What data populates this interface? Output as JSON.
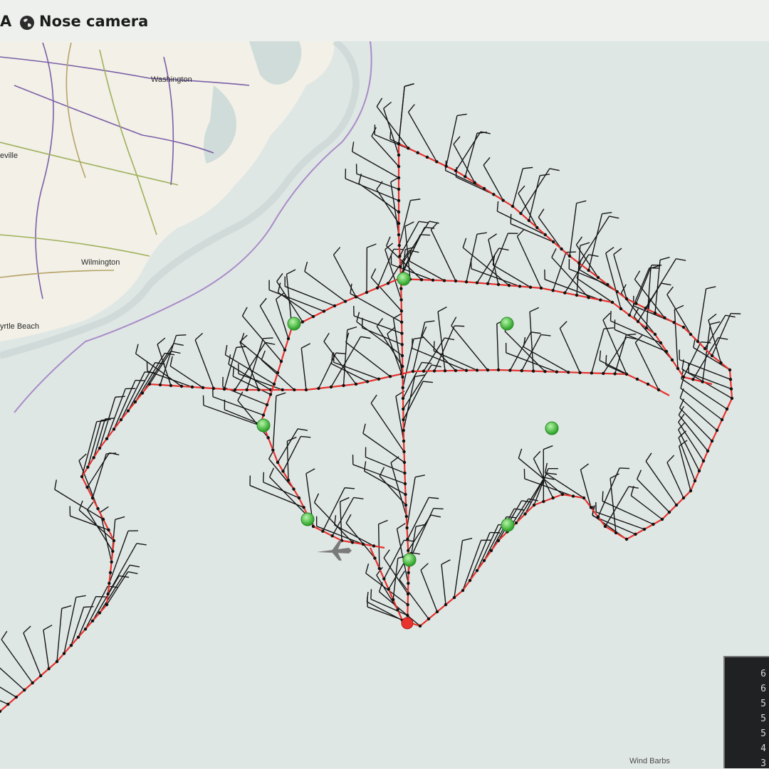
{
  "toolbar": {
    "left_fragment": "A",
    "camera_label": "Nose camera"
  },
  "map": {
    "cities": [
      {
        "name": "Washington"
      },
      {
        "name": "eville"
      },
      {
        "name": "Wilmington"
      },
      {
        "name": "yrtle Beach"
      }
    ],
    "land_color": "#f1efe6",
    "water_color": "#dde6e4",
    "track_color": "#e8322d",
    "waypoint_color": "#3fc23a"
  },
  "data_panel": {
    "values": [
      "6",
      "6",
      "5",
      "5",
      "5",
      "4",
      "3"
    ]
  },
  "legend": {
    "label": "Wind Barbs"
  }
}
